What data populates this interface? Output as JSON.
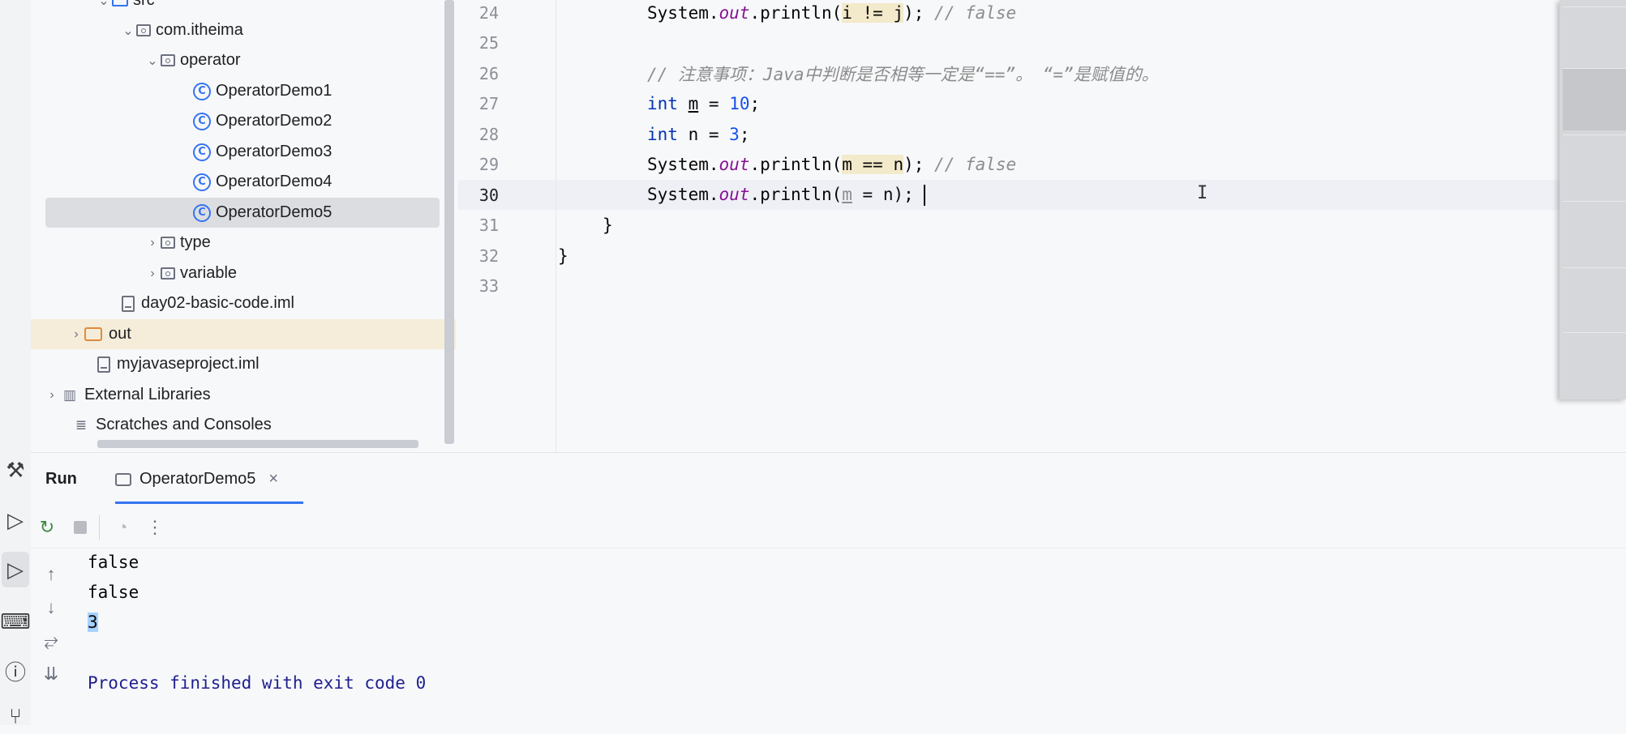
{
  "project_tree": [
    {
      "label": "src",
      "type": "folder-blue",
      "indent": 2,
      "expanded": true
    },
    {
      "label": "com.itheima",
      "type": "package",
      "indent": 3,
      "expanded": true
    },
    {
      "label": "operator",
      "type": "package",
      "indent": 4,
      "expanded": true
    },
    {
      "label": "OperatorDemo1",
      "type": "class",
      "indent": 5
    },
    {
      "label": "OperatorDemo2",
      "type": "class",
      "indent": 5
    },
    {
      "label": "OperatorDemo3",
      "type": "class",
      "indent": 5
    },
    {
      "label": "OperatorDemo4",
      "type": "class",
      "indent": 5
    },
    {
      "label": "OperatorDemo5",
      "type": "class",
      "indent": 5,
      "selected": true
    },
    {
      "label": "type",
      "type": "package",
      "indent": 4,
      "expanded": false
    },
    {
      "label": "variable",
      "type": "package",
      "indent": 4,
      "expanded": false
    },
    {
      "label": "day02-basic-code.iml",
      "type": "file",
      "indent": 3
    },
    {
      "label": "out",
      "type": "folder-orange",
      "indent": 1,
      "expanded": false,
      "highlight": true
    },
    {
      "label": "myjavaseproject.iml",
      "type": "file",
      "indent": 2
    },
    {
      "label": "External Libraries",
      "type": "libraries",
      "indent": 1,
      "expanded": false
    },
    {
      "label": "Scratches and Consoles",
      "type": "scratches",
      "indent": 1
    }
  ],
  "editor": {
    "current_line": "30",
    "lines": [
      {
        "n": "24",
        "code": "System.out.println(i != j); // false"
      },
      {
        "n": "25",
        "code": ""
      },
      {
        "n": "26",
        "code": "// 注意事项：Java中判断是否相等一定是“==”。 “=”是赋值的。"
      },
      {
        "n": "27",
        "code": "int m = 10;"
      },
      {
        "n": "28",
        "code": "int n = 3;"
      },
      {
        "n": "29",
        "code": "System.out.println(m == n); // false"
      },
      {
        "n": "30",
        "code": "System.out.println(m = n);"
      },
      {
        "n": "31",
        "code": "}"
      },
      {
        "n": "32",
        "code": "}"
      },
      {
        "n": "33",
        "code": ""
      }
    ]
  },
  "run_panel": {
    "title": "Run",
    "tab_label": "OperatorDemo5",
    "output": [
      "false",
      "false",
      "3",
      "",
      "Process finished with exit code 0"
    ]
  },
  "colors": {
    "accent": "#3574f0",
    "keyword": "#0033b3",
    "field": "#871094",
    "number": "#1750eb",
    "comment": "#8c8c8c"
  }
}
